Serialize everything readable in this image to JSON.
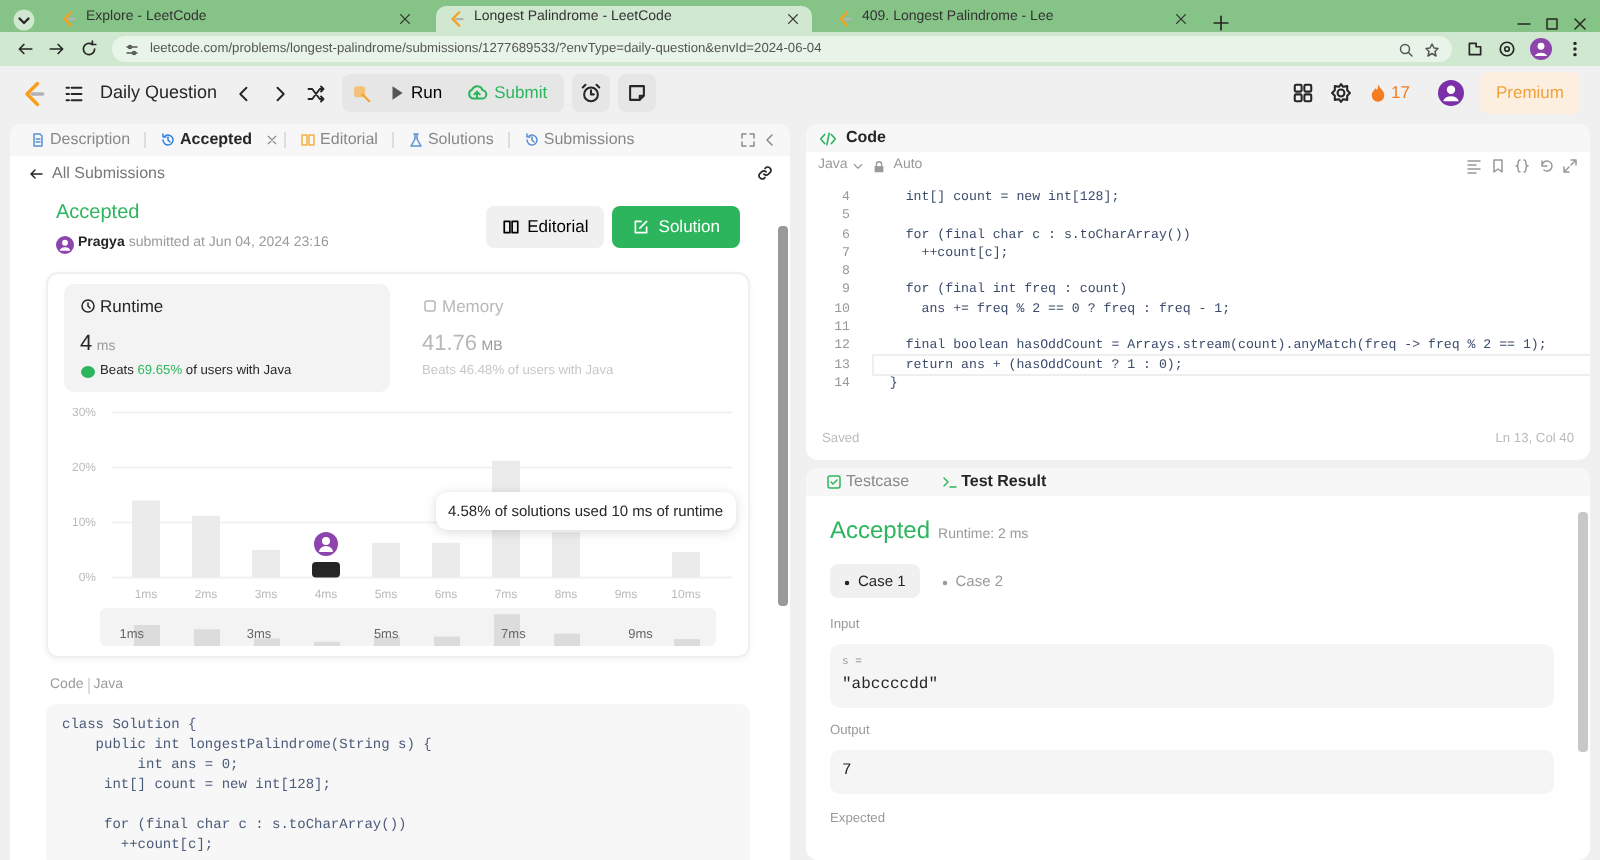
{
  "browser": {
    "tabs": [
      {
        "title": "Explore - LeetCode",
        "selected": false
      },
      {
        "title": "Longest Palindrome - LeetCode",
        "selected": true
      },
      {
        "title": "409. Longest Palindrome - Lee",
        "selected": false
      }
    ],
    "address": "leetcode.com/problems/longest-palindrome/submissions/1277689533/?envType=daily-question&envId=2024-06-04"
  },
  "header": {
    "title": "Daily Question",
    "run": "Run",
    "submit": "Submit",
    "streak": "17",
    "premium": "Premium"
  },
  "left_panel": {
    "tabs": [
      {
        "label": "Description",
        "selected": false,
        "closable": false
      },
      {
        "label": "Accepted",
        "selected": true,
        "closable": true
      },
      {
        "label": "Editorial",
        "selected": false,
        "closable": false
      },
      {
        "label": "Solutions",
        "selected": false,
        "closable": false
      },
      {
        "label": "Submissions",
        "selected": false,
        "closable": false
      }
    ],
    "back_link": "All Submissions",
    "status": "Accepted",
    "author": "Pragya",
    "submitted": "submitted at Jun 04, 2024 23:16",
    "buttons": [
      {
        "label": "Editorial",
        "kind": "secondary"
      },
      {
        "label": "Solution",
        "kind": "primary"
      }
    ],
    "stats": [
      {
        "title": "Runtime",
        "value": "4",
        "unit": "ms",
        "beats": "Beats",
        "percent": "69.65%",
        "suffix": "of users with Java",
        "selected": true
      },
      {
        "title": "Memory",
        "value": "41.76",
        "unit": "MB",
        "beats": "Beats",
        "percent": "46.48%",
        "suffix": "of users with Java",
        "selected": false
      }
    ],
    "chart_data": {
      "type": "bar",
      "categories": [
        "1ms",
        "2ms",
        "3ms",
        "4ms",
        "5ms",
        "6ms",
        "7ms",
        "8ms",
        "9ms",
        "10ms"
      ],
      "series": [
        {
          "color": "#ebebeb",
          "values": [
            14.0,
            11.2,
            5.0,
            null,
            6.3,
            6.3,
            21.2,
            8.2,
            null,
            4.6
          ]
        },
        {
          "color": "#262626",
          "values": [
            null,
            null,
            null,
            2.8,
            null,
            null,
            null,
            null,
            null,
            null
          ]
        }
      ],
      "ylim": [
        0,
        30
      ],
      "yticks": [
        {
          "value": 0,
          "label": "0%"
        },
        {
          "value": 10,
          "label": "10%"
        },
        {
          "value": 20,
          "label": "20%"
        },
        {
          "value": 30,
          "label": "30%"
        }
      ]
    },
    "tooltip": "4.58% of solutions used 10 ms of runtime",
    "overview_labels": [
      "1ms",
      "3ms",
      "5ms",
      "7ms",
      "9ms"
    ],
    "code_label": "Code",
    "code_language": "Java",
    "code": [
      {
        "text": "class Solution {"
      },
      {
        "text": "    public int longestPalindrome(String s) {"
      },
      {
        "text": "         int ans = 0;"
      },
      {
        "text": "     int[] count = new int[128];"
      },
      {
        "kind": "blank"
      },
      {
        "text": "     for (final char c : s.toCharArray())"
      },
      {
        "text": "       ++count[c];"
      }
    ]
  },
  "editor": {
    "title": "Code",
    "language": "Java",
    "mode": "Auto",
    "lines": [
      {
        "number": "4",
        "text": "    int[] count = new int[128];",
        "current": false
      },
      {
        "number": "5",
        "current": false
      },
      {
        "number": "6",
        "text": "    for (final char c : s.toCharArray())",
        "current": false
      },
      {
        "number": "7",
        "text": "      ++count[c];",
        "current": false
      },
      {
        "number": "8",
        "current": false
      },
      {
        "number": "9",
        "text": "    for (final int freq : count)",
        "current": false
      },
      {
        "number": "10",
        "text": "      ans += freq % 2 == 0 ? freq : freq - 1;",
        "current": false
      },
      {
        "number": "11",
        "current": false
      },
      {
        "number": "12",
        "text": "    final boolean hasOddCount = Arrays.stream(count).anyMatch(freq -> freq % 2 == 1);",
        "current": false
      },
      {
        "number": "13",
        "text": "    return ans + (hasOddCount ? 1 : 0);",
        "current": true
      },
      {
        "number": "14",
        "text": "  }",
        "current": false
      }
    ],
    "status": "Saved",
    "cursor": "Ln 13, Col 40"
  },
  "test_panel": {
    "tabs": [
      {
        "label": "Testcase",
        "selected": false
      },
      {
        "label": "Test Result",
        "selected": true
      }
    ],
    "status": "Accepted",
    "runtime": "Runtime: 2 ms",
    "cases": [
      {
        "label": "Case 1",
        "selected": true
      },
      {
        "label": "Case 2",
        "selected": false
      }
    ],
    "input_label": "Input",
    "param": "s =",
    "input_value": "\"abccccdd\"",
    "output_label": "Output",
    "output": "7",
    "expected_label": "Expected"
  }
}
